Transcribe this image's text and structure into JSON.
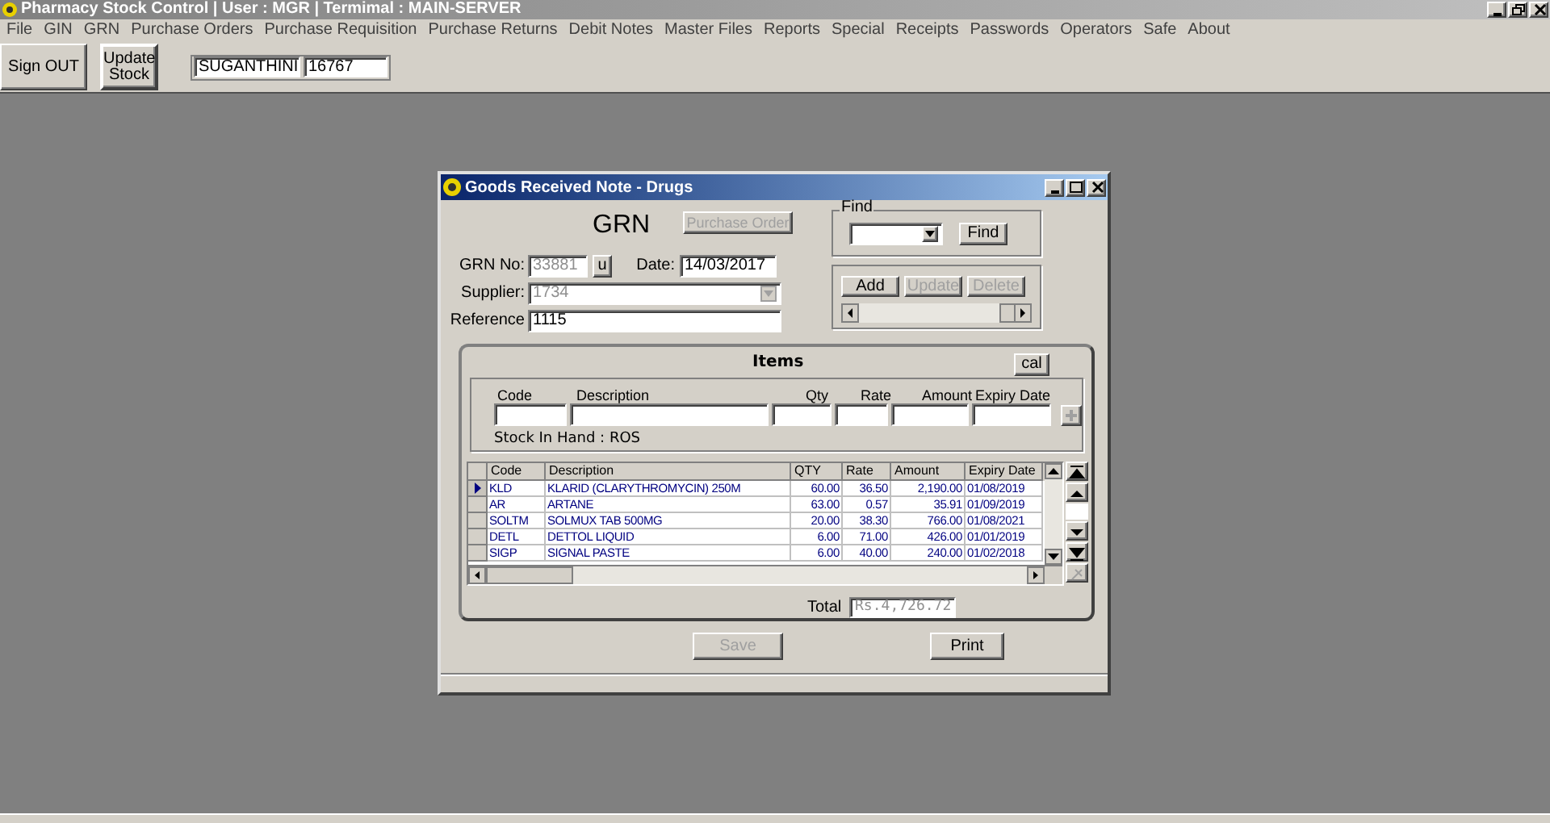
{
  "app_title": "Pharmacy Stock Control | User : MGR | Termimal : MAIN-SERVER",
  "menu": [
    "File",
    "GIN",
    "GRN",
    "Purchase Orders",
    "Purchase Requisition",
    "Purchase Returns",
    "Debit Notes",
    "Master Files",
    "Reports",
    "Special",
    "Receipts",
    "Passwords",
    "Operators",
    "Safe",
    "About"
  ],
  "toolbar": {
    "buttons": [
      {
        "label": "Sign OUT"
      },
      {
        "label": "Update Stock"
      }
    ],
    "user_name": "SUGANTHINI",
    "user_code": "16767"
  },
  "dialog": {
    "title": "Goods Received Note - Drugs",
    "heading": "GRN",
    "purchase_order_button": {
      "label": "Purchase Order",
      "disabled": true
    },
    "grn_no": {
      "label": "GRN No:",
      "value": "33881",
      "disabled": true
    },
    "u_button": {
      "label": "u"
    },
    "date": {
      "label": "Date:",
      "value": "14/03/2017"
    },
    "supplier": {
      "label": "Supplier:",
      "value": "1734",
      "disabled": true
    },
    "reference": {
      "label": "Reference",
      "value": "1115"
    },
    "find": {
      "legend": "Find",
      "button": "Find"
    },
    "actions": [
      {
        "label": "Add",
        "disabled": false
      },
      {
        "label": "Update",
        "disabled": true
      },
      {
        "label": "Delete",
        "disabled": true
      }
    ],
    "items": {
      "title": "Items",
      "cal_button": "cal",
      "entry_columns": [
        "Code",
        "Description",
        "Qty",
        "Rate",
        "Amount",
        "Expiry Date"
      ],
      "stock_in_hand": "Stock In Hand : ROS",
      "table": {
        "columns": [
          "Code",
          "Description",
          "QTY",
          "Rate",
          "Amount",
          "Expiry Date"
        ],
        "rows": [
          {
            "selected": true,
            "cells": [
              "KLD",
              "KLARID (CLARYTHROMYCIN) 250M",
              "60.00",
              "36.50",
              "2,190.00",
              "01/08/2019"
            ]
          },
          {
            "selected": false,
            "cells": [
              "AR",
              "ARTANE",
              "63.00",
              "0.57",
              "35.91",
              "01/09/2019"
            ]
          },
          {
            "selected": false,
            "cells": [
              "SOLTM",
              "SOLMUX TAB 500MG",
              "20.00",
              "38.30",
              "766.00",
              "01/08/2021"
            ]
          },
          {
            "selected": false,
            "cells": [
              "DETL",
              "DETTOL LIQUID",
              "6.00",
              "71.00",
              "426.00",
              "01/01/2019"
            ]
          },
          {
            "selected": false,
            "cells": [
              "SIGP",
              "SIGNAL PASTE",
              "6.00",
              "40.00",
              "240.00",
              "01/02/2018"
            ]
          }
        ]
      },
      "total": {
        "label": "Total",
        "value": "Rs.4,726.72"
      }
    },
    "save_button": {
      "label": "Save",
      "disabled": true
    },
    "print_button": {
      "label": "Print",
      "disabled": false
    }
  }
}
